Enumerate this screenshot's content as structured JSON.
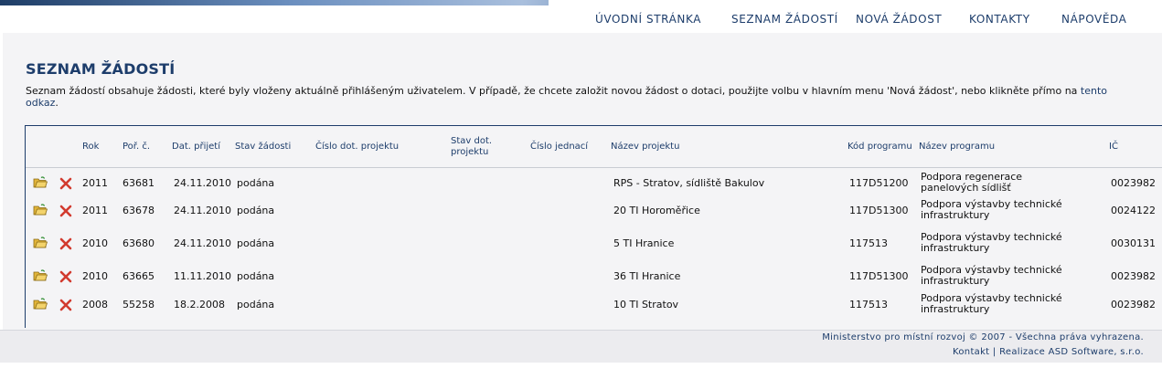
{
  "nav": {
    "items": [
      "ÚVODNÍ STRÁNKA",
      "SEZNAM ŽÁDOSTÍ",
      "NOVÁ ŽÁDOST",
      "KONTAKTY",
      "NÁPOVĚDA"
    ]
  },
  "page": {
    "title": "SEZNAM ŽÁDOSTÍ",
    "intro_text": "Seznam žádostí obsahuje žádosti, které byly vloženy aktuálně přihlášeným uživatelem. V případě, že chcete založit novou žádost o dotaci, použijte volbu v hlavním menu 'Nová žádost', nebo klikněte přímo na",
    "intro_link": "tento odkaz",
    "intro_end": "."
  },
  "table": {
    "headers": {
      "rok": "Rok",
      "por": "Poř. č.",
      "dat": "Dat. přijetí",
      "stav": "Stav žádosti",
      "cislo_dot": "Číslo dot. projektu",
      "stav_dot": "Stav dot. projektu",
      "cislo_jed": "Číslo jednací",
      "nazev": "Název projektu",
      "kod": "Kód programu",
      "nazev_prog": "Název programu",
      "ic": "IČ"
    },
    "rows": [
      {
        "rok": "2011",
        "por": "63681",
        "dat": "24.11.2010",
        "stav": "podána",
        "nazev": "RPS - Stratov, sídliště Bakulov",
        "kod": "117D51200",
        "nazev_prog": "Podpora regenerace panelových sídlišť",
        "ic": "0023982"
      },
      {
        "rok": "2011",
        "por": "63678",
        "dat": "24.11.2010",
        "stav": "podána",
        "nazev": "20 TI Horoměřice",
        "kod": "117D51300",
        "nazev_prog": "Podpora výstavby technické infrastruktury",
        "ic": "0024122"
      },
      {
        "rok": "2010",
        "por": "63680",
        "dat": "24.11.2010",
        "stav": "podána",
        "nazev": "5 TI Hranice",
        "kod": "117513",
        "nazev_prog": "Podpora výstavby technické infrastruktury",
        "ic": "0030131"
      },
      {
        "rok": "2010",
        "por": "63665",
        "dat": "11.11.2010",
        "stav": "podána",
        "nazev": "36 TI Hranice",
        "kod": "117D51300",
        "nazev_prog": "Podpora výstavby technické infrastruktury",
        "ic": "0023982"
      },
      {
        "rok": "2008",
        "por": "55258",
        "dat": "18.2.2008",
        "stav": "podána",
        "nazev": "10 TI Stratov",
        "kod": "117513",
        "nazev_prog": "Podpora výstavby technické infrastruktury",
        "ic": "0023982"
      }
    ]
  },
  "footer": {
    "copyright": "Ministerstvo pro místní rozvoj © 2007 - Všechna práva vyhrazena.",
    "contact": "Kontakt",
    "separator": "|",
    "realization": "Realizace ASD Software, s.r.o."
  },
  "colors": {
    "accent": "#1d3d6b",
    "open_icon": "#d9a826",
    "delete_icon": "#d23a2e"
  },
  "icons": {
    "open": "folder-open-icon",
    "delete": "delete-x-icon"
  }
}
